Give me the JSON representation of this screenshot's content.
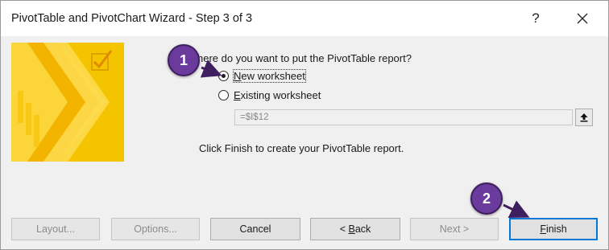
{
  "window": {
    "title": "PivotTable and PivotChart Wizard - Step 3 of 3",
    "help_label": "?",
    "close_icon": "close-icon"
  },
  "wizard": {
    "prompt": "here do you want to put the PivotTable report?",
    "options": [
      {
        "label_prefix": "",
        "label_accel": "N",
        "label_rest": "ew worksheet",
        "checked": true
      },
      {
        "label_prefix": "",
        "label_accel": "E",
        "label_rest": "xisting worksheet",
        "checked": false
      }
    ],
    "reference_value": "=$I$12",
    "info_text": "Click Finish to create your PivotTable report."
  },
  "buttons": {
    "layout": "Layout...",
    "options": "Options...",
    "cancel": "Cancel",
    "back_prefix": "< ",
    "back_accel": "B",
    "back_rest": "ack",
    "next": "Next >",
    "finish_accel": "F",
    "finish_rest": "inish"
  },
  "callouts": [
    {
      "number": "1"
    },
    {
      "number": "2"
    }
  ],
  "colors": {
    "callout": "#6a3a9c",
    "default_button_border": "#0078d7",
    "graphic_yellow": "#f5c400"
  }
}
